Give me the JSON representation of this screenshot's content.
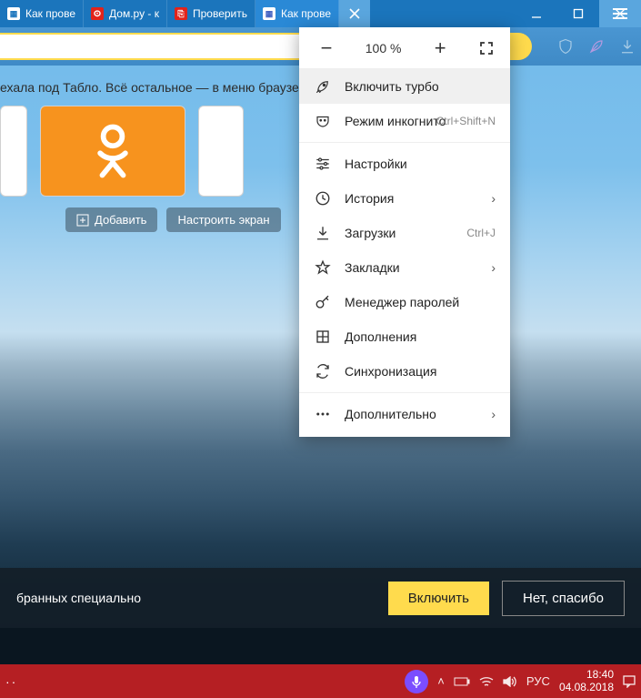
{
  "tabs": [
    {
      "label": "Как прове",
      "favicon_bg": "#ffffff",
      "favicon_fg": "#1b75bc",
      "favicon_text": "▦"
    },
    {
      "label": "Дом.ру - к",
      "favicon_bg": "#e2231a",
      "favicon_fg": "#ffffff",
      "favicon_text": "ⵙ"
    },
    {
      "label": "Проверить",
      "favicon_bg": "#e2231a",
      "favicon_fg": "#ffffff",
      "favicon_text": "⎘"
    },
    {
      "label": "Как прове",
      "favicon_bg": "#ffffff",
      "favicon_fg": "#4060c0",
      "favicon_text": "▦"
    }
  ],
  "info_line": "ехала под Табло. Всё остальное — в меню браузер",
  "tile_buttons": {
    "add": "Добавить",
    "configure": "Настроить экран"
  },
  "zoom": {
    "value": "100 %"
  },
  "menu": {
    "turbo": "Включить турбо",
    "incognito": "Режим инкогнито",
    "incognito_hint": "Ctrl+Shift+N",
    "settings": "Настройки",
    "history": "История",
    "downloads": "Загрузки",
    "downloads_hint": "Ctrl+J",
    "bookmarks": "Закладки",
    "passwords": "Менеджер паролей",
    "addons": "Дополнения",
    "sync": "Синхронизация",
    "more": "Дополнительно"
  },
  "promo": {
    "text": "бранных специально",
    "enable": "Включить",
    "decline": "Нет, спасибо"
  },
  "tray": {
    "lang": "РУС",
    "time": "18:40",
    "date": "04.08.2018"
  }
}
